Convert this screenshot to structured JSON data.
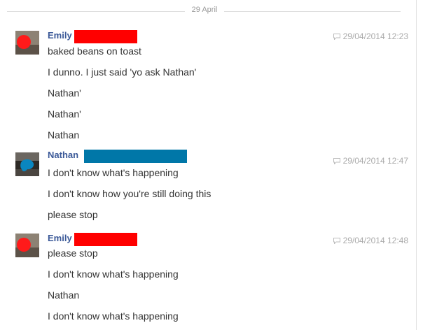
{
  "date_divider": "29 April",
  "colors": {
    "name_blue": "#3b5998",
    "redaction_red": "#ff0000",
    "redaction_blue": "#0077a8",
    "timestamp_gray": "#aaaaaa",
    "divider_gray": "#dddddd"
  },
  "groups": [
    {
      "sender": "Emily",
      "avatar_icon": "profile-photo-redacted-red",
      "redaction_color": "#ff0000",
      "timestamp": "29/04/2014 12:23",
      "messages": [
        "baked beans on toast",
        "I dunno. I just said 'yo ask Nathan'",
        "Nathan'",
        "Nathan'",
        "Nathan"
      ]
    },
    {
      "sender": "Nathan",
      "avatar_icon": "profile-photo-redacted-blue",
      "redaction_color": "#0077a8",
      "timestamp": "29/04/2014 12:47",
      "messages": [
        "I don't know what's happening",
        "I don't know how you're still doing this",
        "please stop"
      ]
    },
    {
      "sender": "Emily",
      "avatar_icon": "profile-photo-redacted-red",
      "redaction_color": "#ff0000",
      "timestamp": "29/04/2014 12:48",
      "messages": [
        "please stop",
        "I don't know what's happening",
        "Nathan",
        "I don't know what's happening"
      ]
    }
  ]
}
